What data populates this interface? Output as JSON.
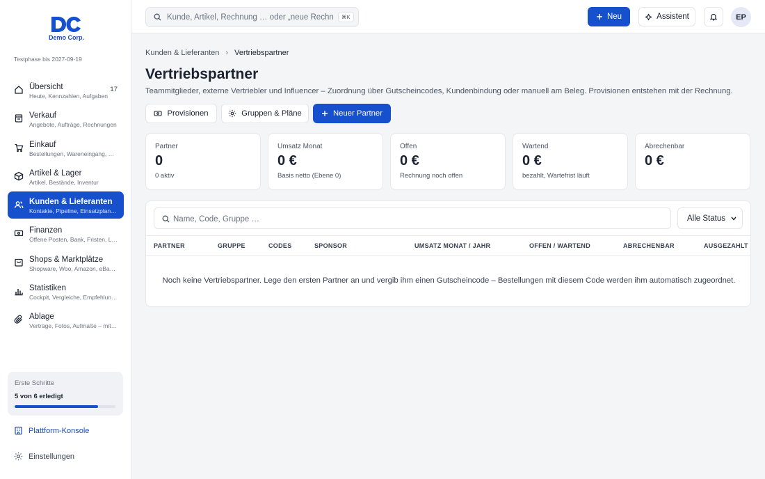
{
  "brand": {
    "name": "Demo Corp.",
    "trial": "Testphase bis 2027-09-19",
    "color": "#1650cc"
  },
  "sidebar": {
    "items": [
      {
        "label": "Übersicht",
        "sub": "Heute, Kennzahlen, Aufgaben",
        "count": "17",
        "icon": "home-icon"
      },
      {
        "label": "Verkauf",
        "sub": "Angebote, Aufträge, Rechnungen",
        "icon": "receipt-icon"
      },
      {
        "label": "Einkauf",
        "sub": "Bestellungen, Wareneingang, Belege",
        "icon": "cart-icon"
      },
      {
        "label": "Artikel & Lager",
        "sub": "Artikel, Bestände, Inventur",
        "icon": "box-icon"
      },
      {
        "label": "Kunden & Lieferanten",
        "sub": "Kontakte, Pipeline, Einsatzplanung",
        "icon": "users-icon",
        "active": true
      },
      {
        "label": "Finanzen",
        "sub": "Offene Posten, Bank, Fristen, Liquidität",
        "icon": "banknote-icon"
      },
      {
        "label": "Shops & Marktplätze",
        "sub": "Shopware, Woo, Amazon, eBay, Kaufland",
        "icon": "shop-icon"
      },
      {
        "label": "Statistiken",
        "sub": "Cockpit, Vergleiche, Empfehlungen",
        "icon": "chart-icon"
      },
      {
        "label": "Ablage",
        "sub": "Verträge, Fotos, Aufmaße – mit Suche",
        "icon": "paperclip-icon"
      }
    ],
    "steps": {
      "title": "Erste Schritte",
      "progress_text": "5 von 6 erledigt",
      "progress": 0.83
    },
    "console_label": "Plattform-Konsole",
    "settings_label": "Einstellungen"
  },
  "header": {
    "search_placeholder": "Kunde, Artikel, Rechnung … oder „neue Rechnung“",
    "search_shortcut": "⌘K",
    "new_label": "Neu",
    "assistant_label": "Assistent",
    "avatar_initials": "EP"
  },
  "main": {
    "breadcrumb": {
      "parent": "Kunden & Lieferanten",
      "current": "Vertriebspartner"
    },
    "title": "Vertriebspartner",
    "description": "Teammitglieder, externe Vertriebler und Influencer – Zuordnung über Gutscheincodes, Kundenbindung oder manuell am Beleg. Provisionen entstehen mit der Rechnung.",
    "actions": {
      "provisions": "Provisionen",
      "groups": "Gruppen & Pläne",
      "new_partner": "Neuer Partner"
    },
    "stats": [
      {
        "label": "Partner",
        "value": "0",
        "sub": "0 aktiv"
      },
      {
        "label": "Umsatz Monat",
        "value": "0 €",
        "sub": "Basis netto (Ebene 0)"
      },
      {
        "label": "Offen",
        "value": "0 €",
        "sub": "Rechnung noch offen"
      },
      {
        "label": "Wartend",
        "value": "0 €",
        "sub": "bezahlt, Wartefrist läuft"
      },
      {
        "label": "Abrechenbar",
        "value": "0 €",
        "sub": ""
      }
    ],
    "table": {
      "filter_placeholder": "Name, Code, Gruppe …",
      "status_selected": "Alle Status",
      "columns": [
        "PARTNER",
        "GRUPPE",
        "CODES",
        "SPONSOR",
        "UMSATZ MONAT / JAHR",
        "OFFEN / WARTEND",
        "ABRECHENBAR",
        "AUSGEZAHLT"
      ],
      "empty_message": "Noch keine Vertriebspartner. Lege den ersten Partner an und vergib ihm einen Gutscheincode – Bestellungen mit diesem Code werden ihm automatisch zugeordnet."
    }
  }
}
